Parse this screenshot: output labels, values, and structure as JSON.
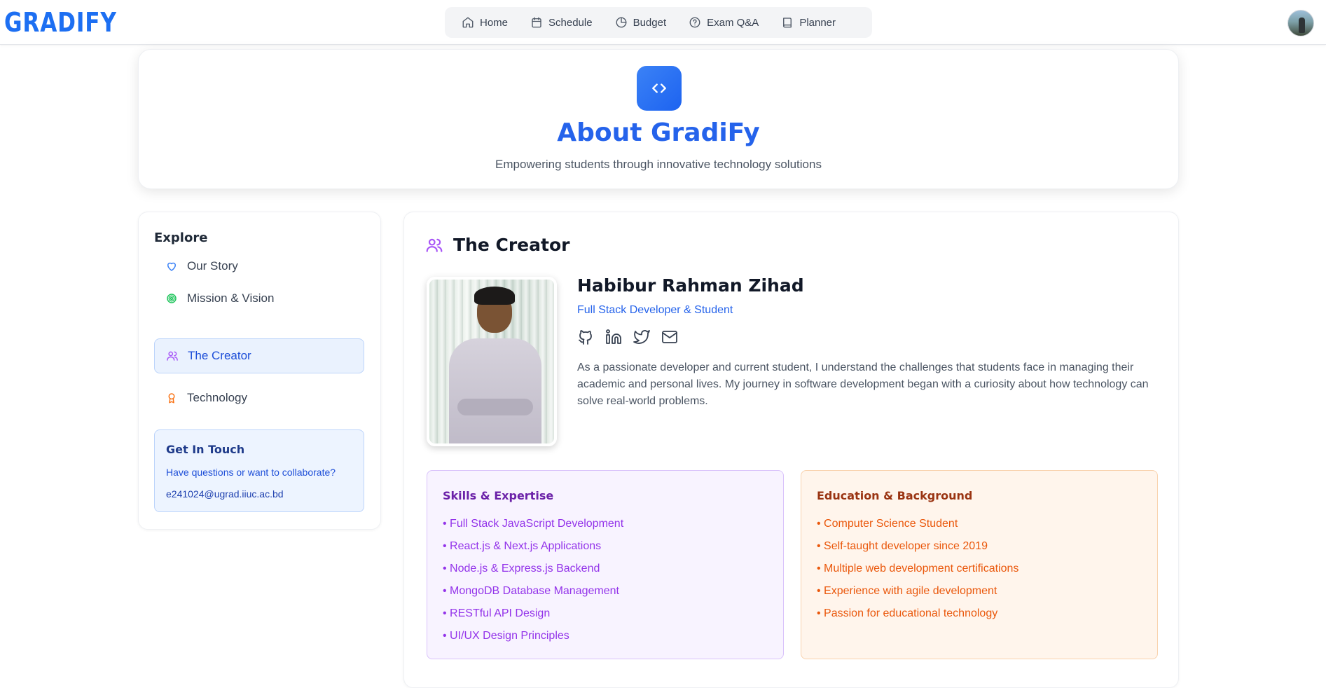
{
  "app": {
    "logo": "GRADIFY"
  },
  "nav": {
    "items": [
      {
        "label": "Home",
        "icon": "home-icon"
      },
      {
        "label": "Schedule",
        "icon": "calendar-icon"
      },
      {
        "label": "Budget",
        "icon": "pie-chart-icon"
      },
      {
        "label": "Exam Q&A",
        "icon": "help-circle-icon"
      },
      {
        "label": "Planner",
        "icon": "book-icon"
      }
    ]
  },
  "hero": {
    "title": "About GradiFy",
    "subtitle": "Empowering students through innovative technology solutions",
    "icon": "code-icon"
  },
  "sidebar": {
    "title": "Explore",
    "items": [
      {
        "label": "Our Story",
        "icon": "heart-icon",
        "color": "#3b82f6"
      },
      {
        "label": "Mission & Vision",
        "icon": "target-icon",
        "color": "#22c55e"
      },
      {
        "label": "The Creator",
        "icon": "users-icon",
        "color": "#a855f7",
        "active": true
      },
      {
        "label": "Technology",
        "icon": "award-icon",
        "color": "#f97316"
      }
    ],
    "contact": {
      "title": "Get In Touch",
      "text": "Have questions or want to collaborate?",
      "email": "e241024@ugrad.iiuc.ac.bd"
    }
  },
  "creator": {
    "section_title": "The Creator",
    "name": "Habibur Rahman Zihad",
    "role": "Full Stack Developer & Student",
    "socials": [
      "github-icon",
      "linkedin-icon",
      "twitter-icon",
      "mail-icon"
    ],
    "bio": "As a passionate developer and current student, I understand the challenges that students face in managing their academic and personal lives. My journey in software development began with a curiosity about how technology can solve real-world problems.",
    "skills": {
      "title": "Skills & Expertise",
      "items": [
        "• Full Stack JavaScript Development",
        "• React.js & Next.js Applications",
        "• Node.js & Express.js Backend",
        "• MongoDB Database Management",
        "• RESTful API Design",
        "• UI/UX Design Principles"
      ]
    },
    "education": {
      "title": "Education & Background",
      "items": [
        "• Computer Science Student",
        "• Self-taught developer since 2019",
        "• Multiple web development certifications",
        "• Experience with agile development",
        "• Passion for educational technology"
      ]
    }
  },
  "colors": {
    "brand": "#1d6ff2",
    "accent": "#2563eb",
    "skills": "#9333ea",
    "education": "#ea580c"
  }
}
